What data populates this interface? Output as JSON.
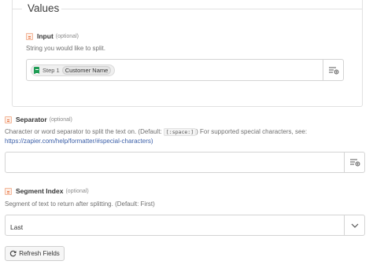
{
  "values_section": {
    "title": "Values"
  },
  "input_field": {
    "label": "Input",
    "optional": "(optional)",
    "help": "String you would like to split.",
    "pill": {
      "step": "Step 1",
      "value": "Customer Name",
      "icon": "google-sheets-icon"
    }
  },
  "separator_field": {
    "label": "Separator",
    "optional": "(optional)",
    "help_before": "Character or word separator to split the text on. (Default:",
    "help_code": "[:space:]",
    "help_after": ") For supported special characters, see:",
    "help_link": "https://zapier.com/help/formatter/#special-characters)",
    "value": ""
  },
  "segment_field": {
    "label": "Segment Index",
    "optional": "(optional)",
    "help": "Segment of text to return after splitting. (Default: First)",
    "selected": "Last"
  },
  "refresh_button": {
    "label": "Refresh Fields"
  }
}
